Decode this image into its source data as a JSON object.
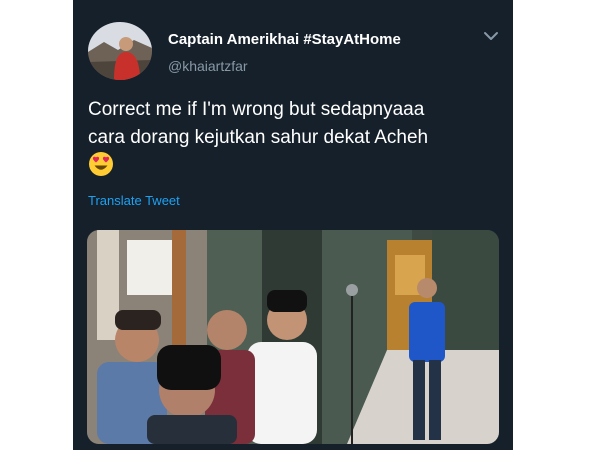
{
  "tweet": {
    "display_name": "Captain Amerikhai #StayAtHome",
    "handle": "@khaiartzfar",
    "text_lines": [
      "Correct me if I'm wrong but sedapnyaaa",
      "cara dorang kejutkan sahur dekat Acheh"
    ],
    "emoji": "heart-eyes-emoji",
    "translate_label": "Translate Tweet"
  },
  "icons": {
    "menu": "chevron-down-icon"
  },
  "colors": {
    "background": "#15202b",
    "text": "#ffffff",
    "secondary_text": "#8899a6",
    "accent": "#1da1f2"
  }
}
